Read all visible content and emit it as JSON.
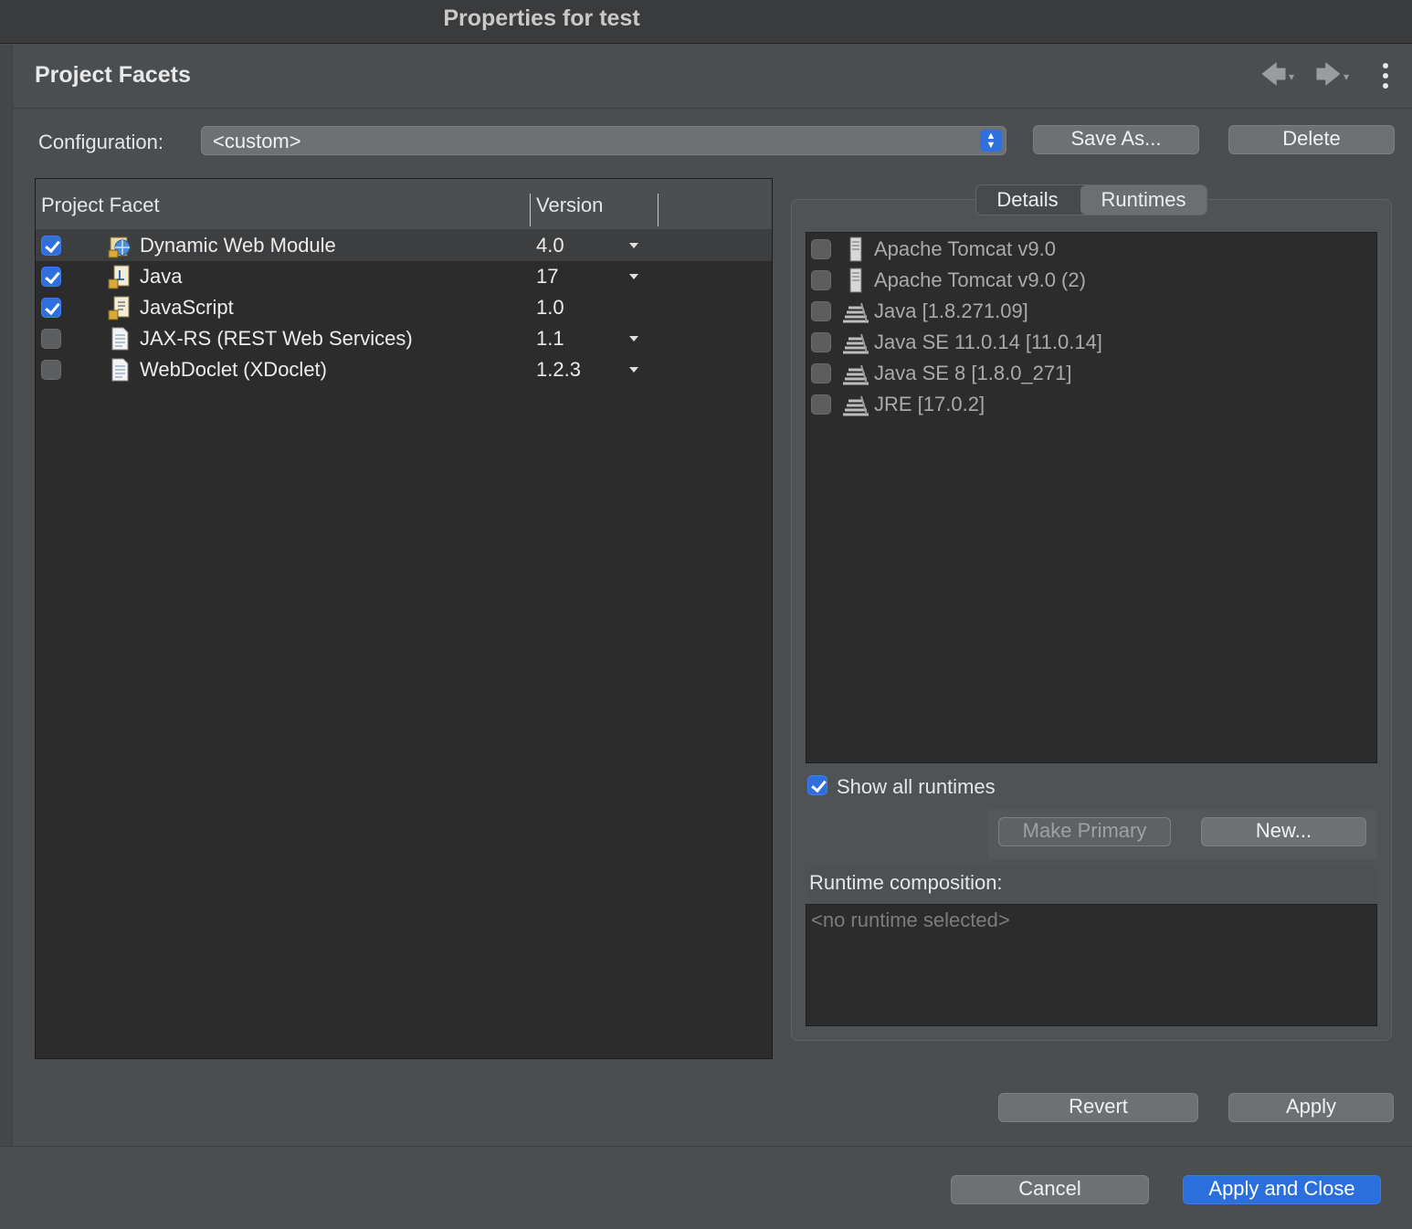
{
  "window": {
    "title": "Properties for test"
  },
  "header": {
    "title": "Project Facets",
    "back_icon": "arrow-left-icon",
    "forward_icon": "arrow-right-icon",
    "menu_icon": "more-vertical-icon"
  },
  "configuration": {
    "label": "Configuration:",
    "value": "<custom>",
    "save_as_label": "Save As...",
    "delete_label": "Delete"
  },
  "facets": {
    "columns": [
      "Project Facet",
      "Version"
    ],
    "rows": [
      {
        "name": "Dynamic Web Module",
        "version": "4.0",
        "checked": true,
        "icon": "web-module-icon",
        "has_dropdown": true
      },
      {
        "name": "Java",
        "version": "17",
        "checked": true,
        "icon": "java-facet-icon",
        "has_dropdown": true
      },
      {
        "name": "JavaScript",
        "version": "1.0",
        "checked": true,
        "icon": "javascript-facet-icon",
        "has_dropdown": false
      },
      {
        "name": "JAX-RS (REST Web Services)",
        "version": "1.1",
        "checked": false,
        "icon": "document-icon",
        "has_dropdown": true
      },
      {
        "name": "WebDoclet (XDoclet)",
        "version": "1.2.3",
        "checked": false,
        "icon": "document-icon",
        "has_dropdown": true
      }
    ]
  },
  "details_tabs": {
    "tabs": [
      "Details",
      "Runtimes"
    ],
    "active": "Runtimes"
  },
  "runtimes": {
    "items": [
      {
        "name": "Apache Tomcat v9.0",
        "icon": "server-icon",
        "checked": false
      },
      {
        "name": "Apache Tomcat v9.0 (2)",
        "icon": "server-icon",
        "checked": false
      },
      {
        "name": "Java [1.8.271.09]",
        "icon": "jre-library-icon",
        "checked": false
      },
      {
        "name": "Java SE 11.0.14 [11.0.14]",
        "icon": "jre-library-icon",
        "checked": false
      },
      {
        "name": "Java SE 8 [1.8.0_271]",
        "icon": "jre-library-icon",
        "checked": false
      },
      {
        "name": "JRE [17.0.2]",
        "icon": "jre-library-icon",
        "checked": false
      }
    ],
    "show_all_label": "Show all runtimes",
    "show_all_checked": true,
    "make_primary_label": "Make Primary",
    "new_label": "New...",
    "composition_label": "Runtime composition:",
    "composition_placeholder": "<no runtime selected>"
  },
  "actions": {
    "revert_label": "Revert",
    "apply_label": "Apply",
    "cancel_label": "Cancel",
    "apply_close_label": "Apply and Close"
  },
  "colors": {
    "accent": "#2b6fdc",
    "background": "#4b4e51",
    "list_background": "#2c2c2c"
  }
}
